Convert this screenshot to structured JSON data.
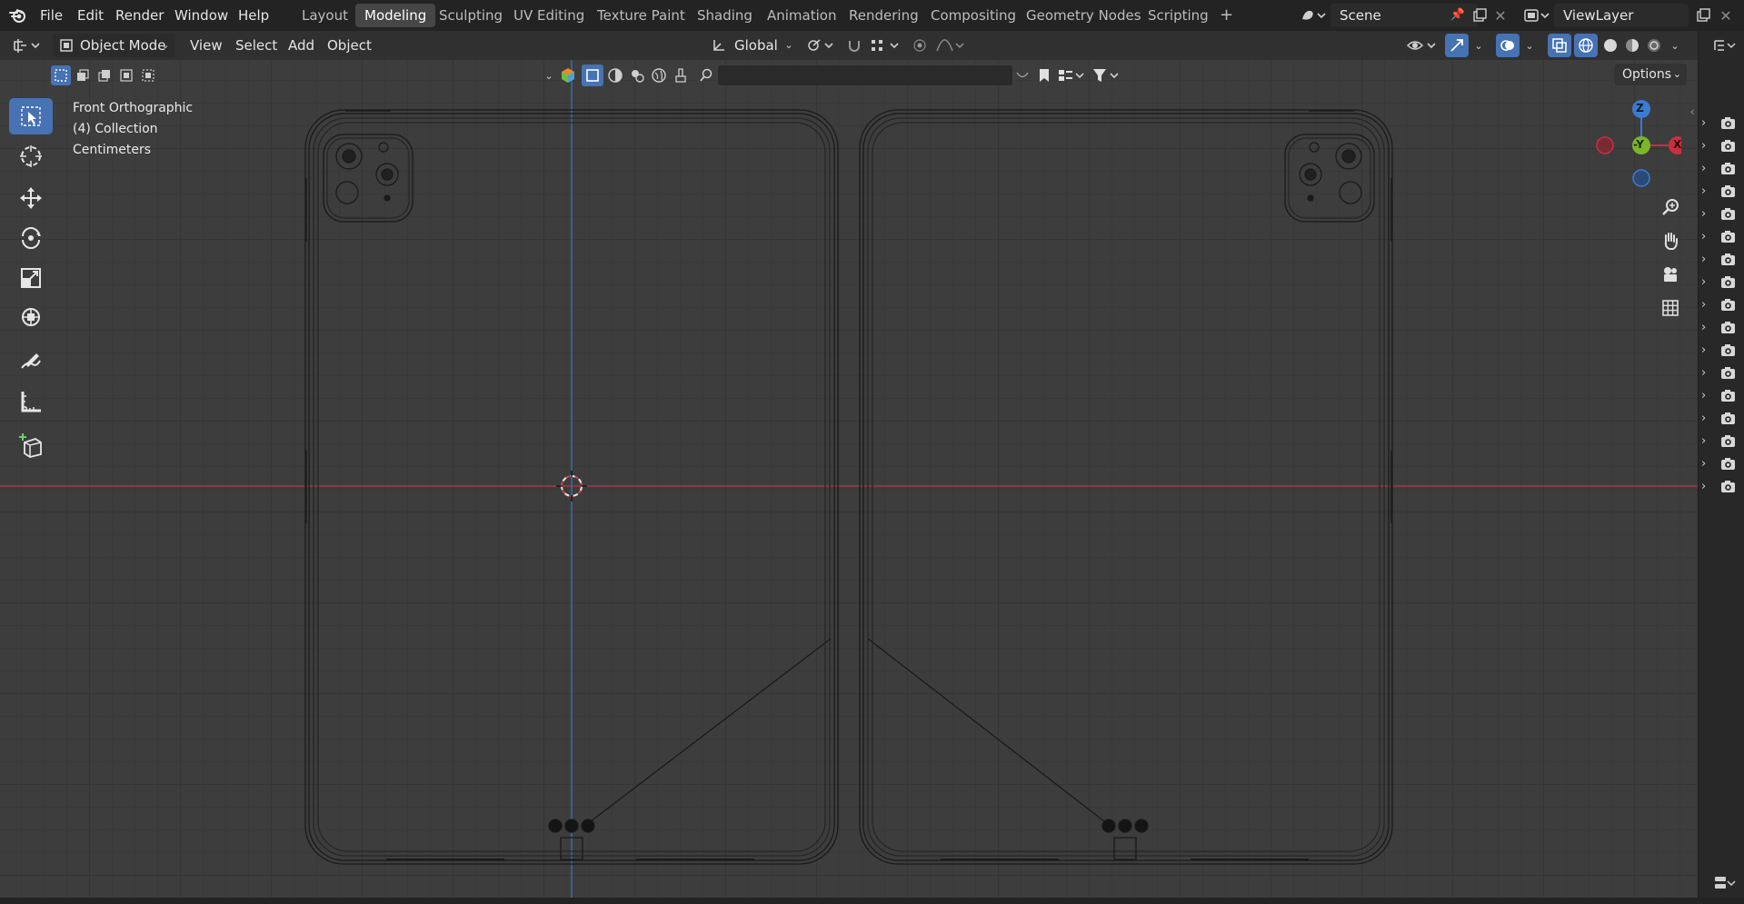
{
  "menu": {
    "items": [
      "File",
      "Edit",
      "Render",
      "Window",
      "Help"
    ]
  },
  "workspaces": {
    "tabs": [
      "Layout",
      "Modeling",
      "Sculpting",
      "UV Editing",
      "Texture Paint",
      "Shading",
      "Animation",
      "Rendering",
      "Compositing",
      "Geometry Nodes",
      "Scripting"
    ],
    "active": "Modeling",
    "add_symbol": "+"
  },
  "scene": {
    "name": "Scene",
    "view_layer": "ViewLayer"
  },
  "header": {
    "mode": "Object Mode",
    "menus": [
      "View",
      "Select",
      "Add",
      "Object"
    ],
    "transform_orientation": "Global"
  },
  "viewport": {
    "view_name": "Front Orthographic",
    "collection": "(4) Collection",
    "units": "Centimeters",
    "options_label": "Options",
    "gizmo": {
      "z": "Z",
      "y": "-Y",
      "x": "X"
    },
    "search_placeholder": ""
  },
  "tools": [
    "select-box",
    "cursor",
    "move",
    "rotate",
    "scale",
    "transform",
    "annotate",
    "measure",
    "add-cube"
  ],
  "outliner": {
    "row_count": 17
  },
  "colors": {
    "accent": "#4772b3",
    "x_axis": "#c8303f",
    "y_axis": "#7ab52a",
    "z_axis": "#3a7cd1",
    "background": "#3d3d3d"
  }
}
